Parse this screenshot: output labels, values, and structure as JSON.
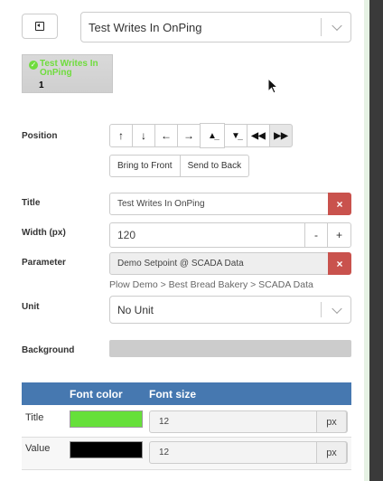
{
  "header": {
    "back_icon": "back-square-icon",
    "widget_select_value": "Test Writes In OnPing"
  },
  "preview": {
    "title": "Test Writes In OnPing",
    "value": "1",
    "title_color": "#6fdc3d"
  },
  "position": {
    "label": "Position",
    "arrows": [
      {
        "icon": "arrow-up-icon",
        "glyph": "🡑"
      },
      {
        "icon": "arrow-down-icon",
        "glyph": "🡓"
      },
      {
        "icon": "arrow-left-icon",
        "glyph": "🡐"
      },
      {
        "icon": "arrow-right-icon",
        "glyph": "🡒"
      },
      {
        "icon": "double-up-icon",
        "glyph": "⏫"
      },
      {
        "icon": "double-down-icon",
        "glyph": "⏬"
      },
      {
        "icon": "double-left-icon",
        "glyph": "⏪"
      },
      {
        "icon": "double-right-icon",
        "glyph": "⏩"
      }
    ],
    "bring_to_front": "Bring to Front",
    "send_to_back": "Send to Back"
  },
  "title": {
    "label": "Title",
    "value": "Test Writes In OnPing",
    "clear": "×"
  },
  "width": {
    "label": "Width (px)",
    "value": "120",
    "minus": "-",
    "plus": "+"
  },
  "parameter": {
    "label": "Parameter",
    "value": "Demo Setpoint @ SCADA Data",
    "clear": "×",
    "path": "Plow Demo > Best Bread Bakery > SCADA Data"
  },
  "unit": {
    "label": "Unit",
    "value": "No Unit"
  },
  "background": {
    "label": "Background",
    "color": "#cccccc"
  },
  "font_table": {
    "col_color": "Font color",
    "col_size": "Font size",
    "header_color": "#4678b0",
    "rows": [
      {
        "label": "Title",
        "color": "#66e03a",
        "size": "12",
        "unit": "px"
      },
      {
        "label": "Value",
        "color": "#000000",
        "size": "12",
        "unit": "px"
      }
    ]
  }
}
